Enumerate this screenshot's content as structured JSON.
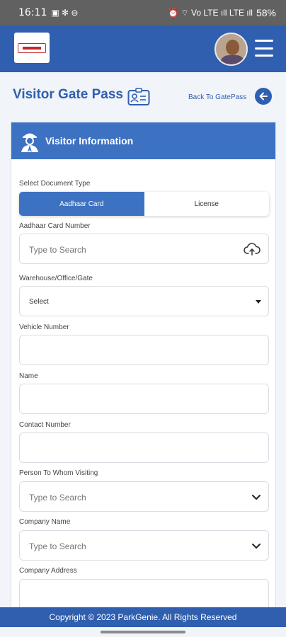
{
  "status_bar": {
    "time": "16:11",
    "left_glyphs": "▣ ✻ ⊖",
    "right_glyphs": "⏰ ⌔ Vo LTE ıll LTE ıll",
    "battery": "58%"
  },
  "header": {
    "logo": "company-logo",
    "avatar": "user-avatar",
    "menu_icon": "hamburger-menu-icon"
  },
  "page": {
    "title": "Visitor Gate Pass",
    "back_label": "Back To GatePass"
  },
  "card": {
    "title": "Visitor Information"
  },
  "form": {
    "document_type_label": "Select Document Type",
    "document_types": [
      "Aadhaar Card",
      "License"
    ],
    "selected_document_type": "Aadhaar Card",
    "aadhaar_label": "Aadhaar Card Number",
    "aadhaar_placeholder": "Type to Search",
    "warehouse_label": "Warehouse/Office/Gate",
    "warehouse_value": "Select",
    "vehicle_label": "Vehicle Number",
    "vehicle_value": "",
    "name_label": "Name",
    "name_value": "",
    "contact_label": "Contact Number",
    "contact_value": "",
    "person_label": "Person To Whom Visiting",
    "person_placeholder": "Type to Search",
    "company_label": "Company Name",
    "company_placeholder": "Type to Search",
    "address_label": "Company Address",
    "address_value": ""
  },
  "footer": {
    "copyright": "Copyright © 2023 ParkGenie. All Rights Reserved"
  },
  "colors": {
    "primary": "#2f5fae",
    "accent": "#3d72c2",
    "background": "#f1f4f9"
  }
}
